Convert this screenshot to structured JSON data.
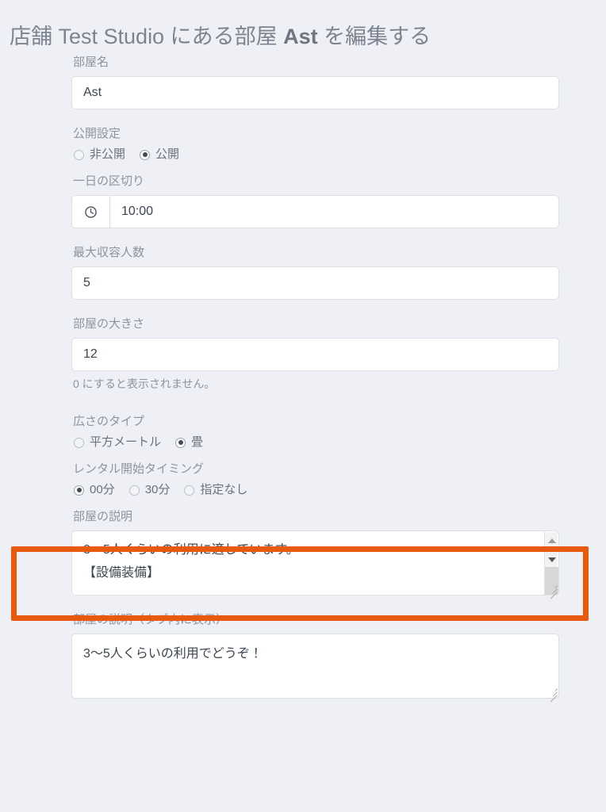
{
  "header": {
    "title_prefix": "店舗 Test Studio にある部屋 ",
    "title_emphasis": "Ast",
    "title_suffix": " を編集する"
  },
  "form": {
    "room_name": {
      "label": "部屋名",
      "value": "Ast"
    },
    "visibility": {
      "label": "公開設定",
      "options": [
        {
          "label": "非公開",
          "selected": false
        },
        {
          "label": "公開",
          "selected": true
        }
      ],
      "option_private_label": "非公開",
      "option_public_label": "公開"
    },
    "day_boundary": {
      "label": "一日の区切り",
      "value": "10:00",
      "icon": "clock-icon"
    },
    "max_capacity": {
      "label": "最大収容人数",
      "value": "5"
    },
    "room_size": {
      "label": "部屋の大きさ",
      "value": "12",
      "helper": "0 にすると表示されません。"
    },
    "size_type": {
      "label": "広さのタイプ",
      "option_sqm_label": "平方メートル",
      "option_tatami_label": "畳",
      "options": [
        {
          "label": "平方メートル",
          "selected": false
        },
        {
          "label": "畳",
          "selected": true
        }
      ]
    },
    "rental_start_timing": {
      "label": "レンタル開始タイミング",
      "option_00_label": "00分",
      "option_30_label": "30分",
      "option_none_label": "指定なし",
      "options": [
        {
          "label": "00分",
          "selected": true
        },
        {
          "label": "30分",
          "selected": false
        },
        {
          "label": "指定なし",
          "selected": false
        }
      ],
      "highlight_color": "#e8590c"
    },
    "room_description": {
      "label": "部屋の説明",
      "value": "3〜5人くらいの利用に適しています。\n【設備装備】"
    },
    "room_description_tab": {
      "label": "部屋の説明（タブ内に表示）",
      "value": "3〜5人くらいの利用でどうぞ！"
    }
  },
  "colors": {
    "background": "#eff0f5",
    "label_text": "#8d949f",
    "input_text": "#3c4450",
    "title_text": "#7c8491",
    "highlight_orange": "#e8590c"
  }
}
